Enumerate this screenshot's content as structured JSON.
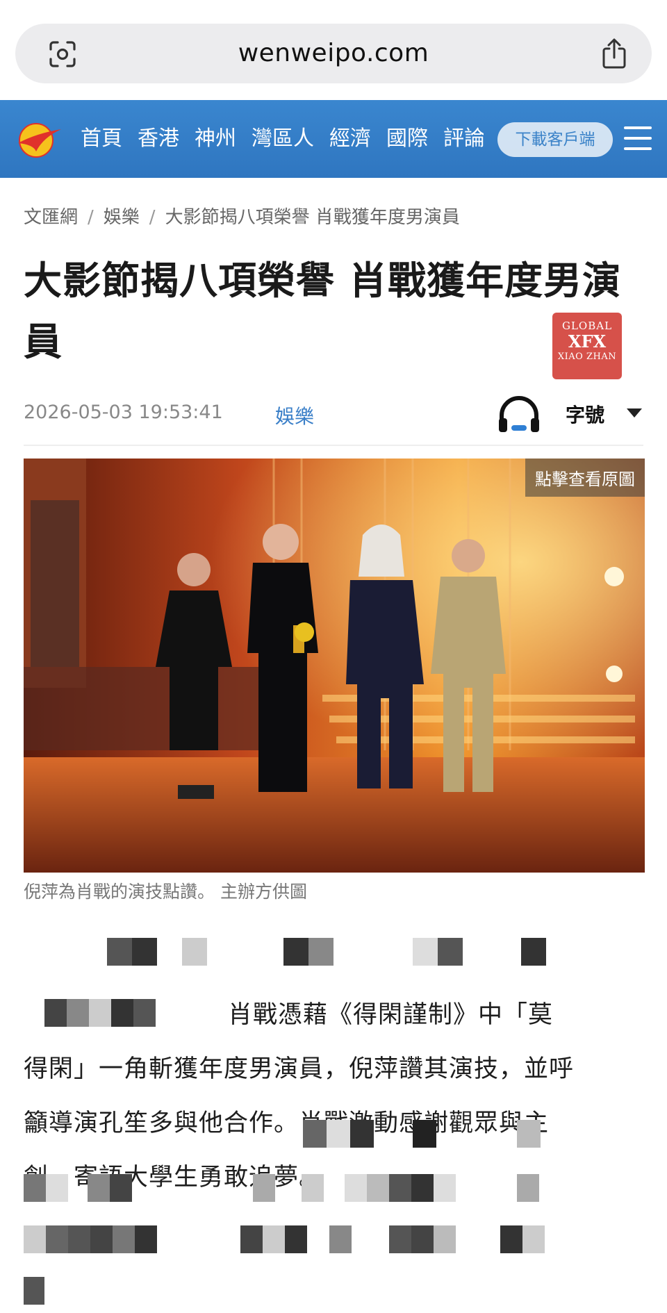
{
  "browser": {
    "url": "wenweipo.com"
  },
  "nav": {
    "items": [
      "首頁",
      "香港",
      "神州",
      "灣區人",
      "經濟",
      "國際",
      "評論"
    ],
    "download_label": "下載客戶端"
  },
  "breadcrumb": [
    "文匯網",
    "娛樂",
    "大影節揭八項榮譽 肖戰獲年度男演員"
  ],
  "article": {
    "title": "大影節揭八項榮譽 肖戰獲年度男演員",
    "seal_lines": [
      "GLOBAL",
      "XFX",
      "XIAO ZHAN"
    ],
    "date": "2026-05-03 19:53:41",
    "category": "娛樂",
    "font_size_label": "字號",
    "photo_badge": "點擊查看原圖",
    "photo_caption": "倪萍為肖戰的演技點讚。 主辦方供圖",
    "paragraph_lines": [
      "肖戰憑藉《得閑謹制》中「莫",
      "得閑」一角斬獲年度男演員，倪萍讚其演技，並呼",
      "籲導演孔笙多與他合作。肖戰激動感謝觀眾與主",
      "創，寄語大學生勇敢追夢。"
    ]
  },
  "colors": {
    "nav_blue": "#3a86cf",
    "link_blue": "#3a7fc8",
    "seal_red": "#d6514a"
  }
}
